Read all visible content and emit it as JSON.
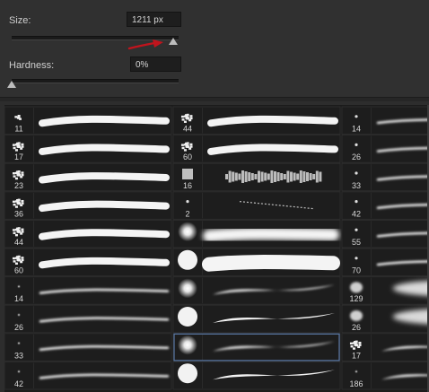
{
  "panel": {
    "size_label": "Size:",
    "size_value": "1211 px",
    "size_slider_fraction": 0.97,
    "hardness_label": "Hardness:",
    "hardness_value": "0%",
    "hardness_slider_fraction": 0.0
  },
  "colors": {
    "annotation_arrow": "#c1141d",
    "selection": "#5a7aa8"
  },
  "brush_grid": {
    "columns": [
      {
        "cells": [
          {
            "size": "11",
            "thumb": "splatter-small",
            "stroke": "hard-thick"
          },
          {
            "size": "17",
            "thumb": "splatter",
            "stroke": "hard-thick"
          },
          {
            "size": "23",
            "thumb": "splatter",
            "stroke": "hard-thick"
          },
          {
            "size": "36",
            "thumb": "splatter",
            "stroke": "hard-thick"
          },
          {
            "size": "44",
            "thumb": "splatter",
            "stroke": "hard-thick"
          },
          {
            "size": "60",
            "thumb": "splatter",
            "stroke": "hard-thick"
          },
          {
            "size": "14",
            "thumb": "soft-dot",
            "stroke": "soft-thin"
          },
          {
            "size": "26",
            "thumb": "soft-dot",
            "stroke": "soft-thin"
          },
          {
            "size": "33",
            "thumb": "soft-dot",
            "stroke": "soft-thin"
          },
          {
            "size": "42",
            "thumb": "soft-dot",
            "stroke": "soft-thin"
          }
        ]
      },
      {
        "cells": [
          {
            "size": "44",
            "thumb": "splatter",
            "stroke": "hard-thick"
          },
          {
            "size": "60",
            "thumb": "splatter",
            "stroke": "hard-thick"
          },
          {
            "size": "16",
            "thumb": "chalk",
            "stroke": "chalk"
          },
          {
            "size": "2",
            "thumb": "dot",
            "stroke": "dry"
          },
          {
            "size": "",
            "thumb": "soft-round",
            "stroke": "soft-wide"
          },
          {
            "size": "",
            "thumb": "hard-round",
            "stroke": "hard-wide"
          },
          {
            "size": "",
            "thumb": "soft-round",
            "stroke": "taper"
          },
          {
            "size": "",
            "thumb": "hard-round",
            "stroke": "taper-hard"
          },
          {
            "size": "",
            "thumb": "soft-round",
            "stroke": "taper",
            "selected": true
          },
          {
            "size": "",
            "thumb": "hard-round",
            "stroke": "taper-hard"
          }
        ]
      },
      {
        "cells": [
          {
            "size": "14",
            "thumb": "dot",
            "stroke": "soft-thin"
          },
          {
            "size": "26",
            "thumb": "dot",
            "stroke": "soft-thin"
          },
          {
            "size": "33",
            "thumb": "dot",
            "stroke": "soft-thin"
          },
          {
            "size": "42",
            "thumb": "dot",
            "stroke": "soft-thin"
          },
          {
            "size": "55",
            "thumb": "dot",
            "stroke": "soft-thin"
          },
          {
            "size": "70",
            "thumb": "dot",
            "stroke": "soft-thin"
          },
          {
            "size": "129",
            "thumb": "cloud",
            "stroke": "cloud"
          },
          {
            "size": "26",
            "thumb": "cloud",
            "stroke": "cloud"
          },
          {
            "size": "17",
            "thumb": "splatter",
            "stroke": "taper"
          },
          {
            "size": "186",
            "thumb": "soft-dot",
            "stroke": "taper"
          }
        ]
      }
    ]
  }
}
